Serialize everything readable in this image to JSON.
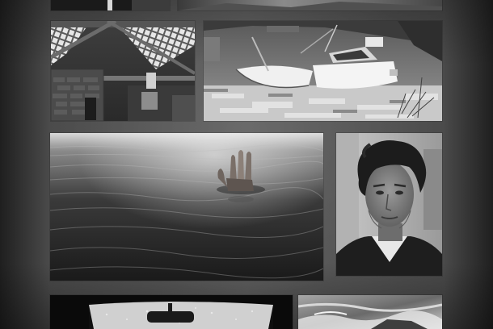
{
  "gallery": {
    "tiles": [
      {
        "id": "top-left",
        "icon": "photo-dark-figure"
      },
      {
        "id": "top-right",
        "icon": "photo-hillside"
      },
      {
        "id": "attic",
        "icon": "photo-ruined-attic"
      },
      {
        "id": "boats",
        "icon": "photo-wrecked-boats"
      },
      {
        "id": "water",
        "icon": "photo-hand-in-water"
      },
      {
        "id": "portrait",
        "icon": "photo-man-portrait"
      },
      {
        "id": "car",
        "icon": "photo-car-windshield"
      },
      {
        "id": "sea",
        "icon": "photo-stormy-sea"
      }
    ]
  },
  "colors": {
    "background": "#5e5e5e",
    "background_edge": "#1f1f1f"
  }
}
